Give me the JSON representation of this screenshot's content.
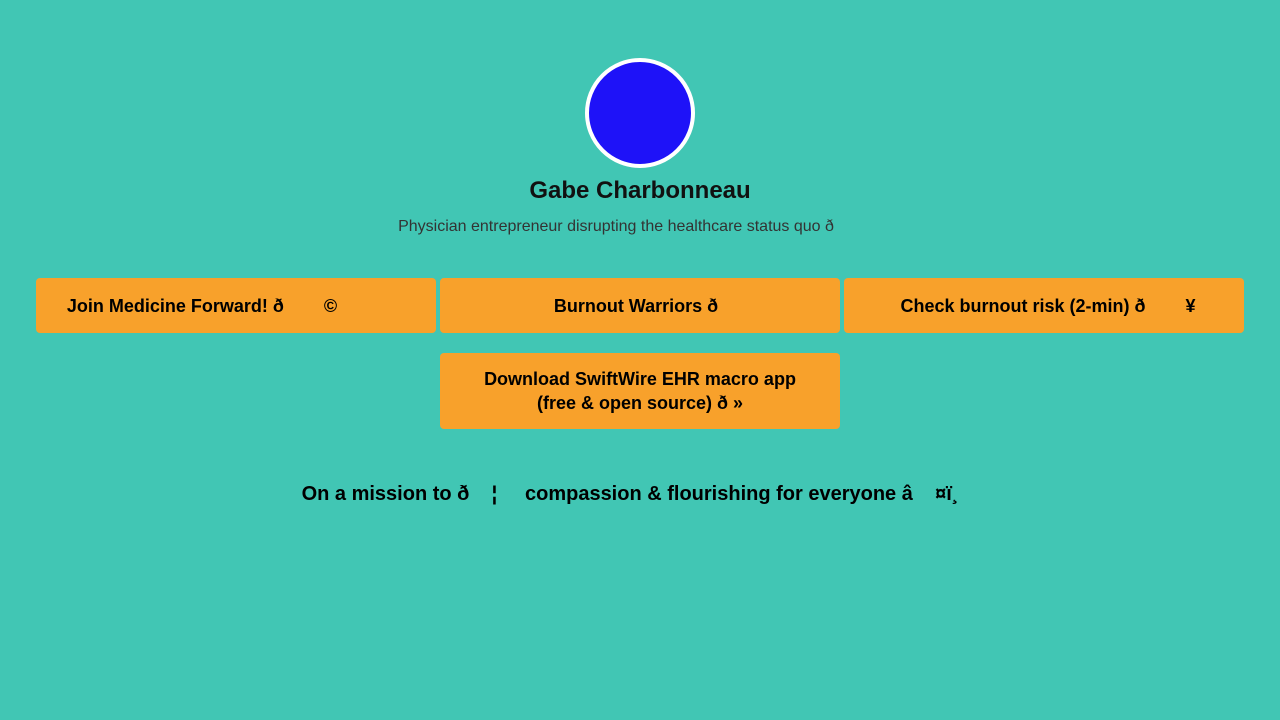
{
  "profile": {
    "avatar_color": "#1e12f8",
    "name": "Gabe Charbonneau",
    "bio": "Physician entrepreneur disrupting the healthcare status quo ð"
  },
  "links": [
    {
      "label": "Join Medicine Forward! ð        ©"
    },
    {
      "label": "Burnout Warriors ð"
    },
    {
      "label": "Check burnout risk (2-min) ð        ¥"
    },
    {
      "label": "Download SwiftWire EHR macro app\n(free & open source) ð        »"
    }
  ],
  "footer": {
    "mission": "On a mission to ð    ¦     compassion & flourishing for everyone â    ¤ï¸"
  },
  "colors": {
    "background": "#41c6b4",
    "button": "#f8a12b",
    "avatar_border": "#ffffff"
  }
}
